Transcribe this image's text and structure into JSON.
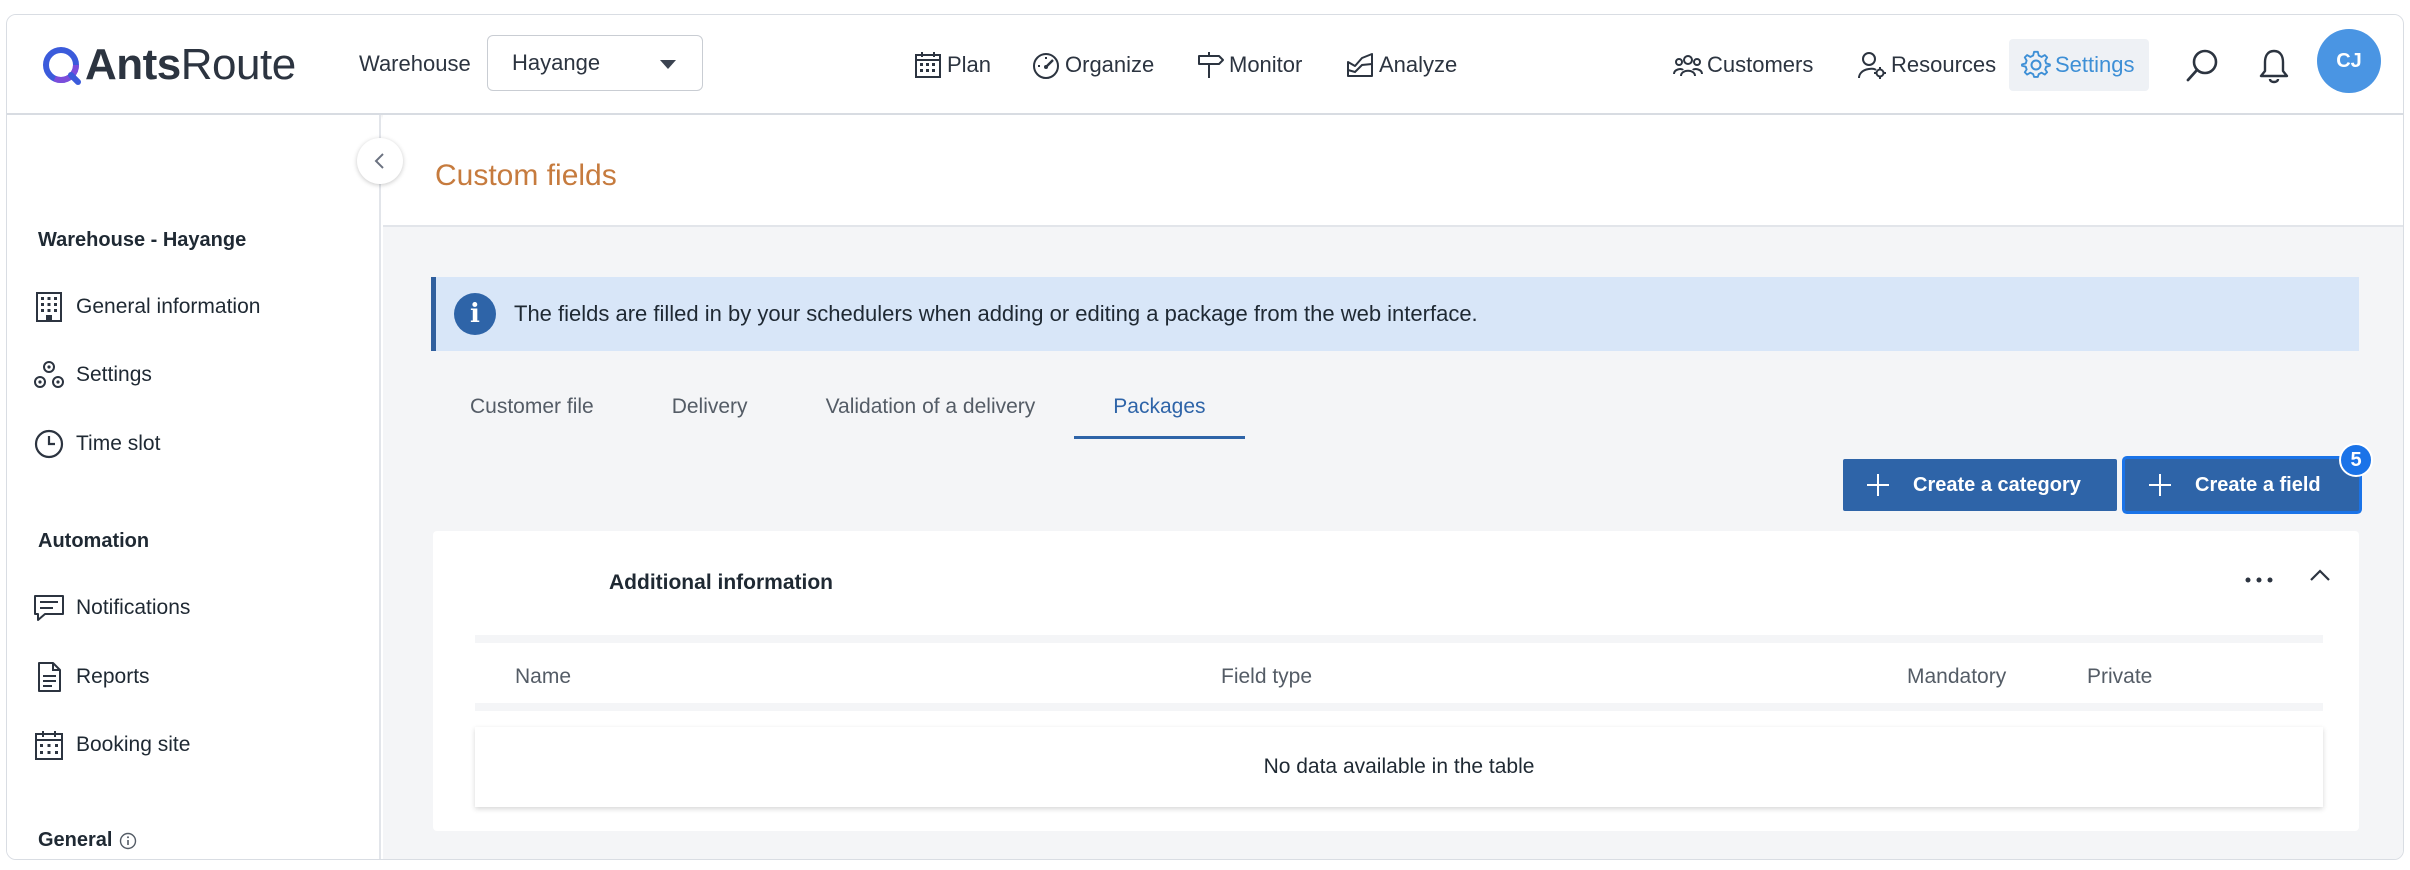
{
  "app": {
    "logo_bold": "Ants",
    "logo_light": "Route"
  },
  "header": {
    "warehouse_label": "Warehouse",
    "warehouse_value": "Hayange",
    "nav": {
      "plan": "Plan",
      "organize": "Organize",
      "monitor": "Monitor",
      "analyze": "Analyze",
      "customers": "Customers",
      "resources": "Resources",
      "settings": "Settings"
    },
    "avatar_initials": "CJ",
    "accent_color": "#3d8fd6"
  },
  "sidebar": {
    "section_warehouse": "Warehouse - Hayange",
    "items": {
      "general_information": "General information",
      "settings": "Settings",
      "time_slot": "Time slot",
      "notifications": "Notifications",
      "reports": "Reports",
      "booking_site": "Booking site"
    },
    "section_automation": "Automation",
    "section_general": "General"
  },
  "page": {
    "title": "Custom fields",
    "title_color": "#c67b3e",
    "info_text": "The fields are filled in by your schedulers when adding or editing a package from the web interface.",
    "tabs": {
      "customer_file": "Customer file",
      "delivery": "Delivery",
      "validation": "Validation of a delivery",
      "packages": "Packages"
    },
    "active_tab": "Packages",
    "buttons": {
      "create_category": "Create a category",
      "create_field": "Create a field",
      "create_field_badge": "5"
    },
    "card": {
      "title": "Additional information",
      "columns": {
        "name": "Name",
        "field_type": "Field type",
        "mandatory": "Mandatory",
        "private": "Private"
      },
      "empty_message": "No data available in the table"
    }
  }
}
